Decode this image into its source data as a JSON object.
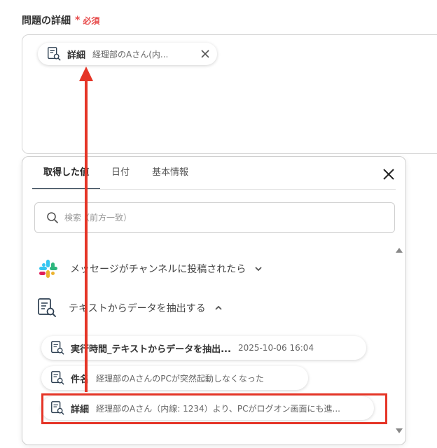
{
  "field": {
    "label": "問題の詳細",
    "required_mark": "*",
    "required_text": "必須",
    "chip": {
      "title": "詳細",
      "value": "経理部のAさん(内..."
    }
  },
  "panel": {
    "tabs": [
      {
        "label": "取得した値",
        "active": true
      },
      {
        "label": "日付",
        "active": false
      },
      {
        "label": "基本情報",
        "active": false
      }
    ],
    "search": {
      "placeholder": "検索（前方一致）",
      "value": ""
    },
    "groups": [
      {
        "label": "メッセージがチャンネルに投稿されたら",
        "icon": "slack-icon",
        "expanded": false
      },
      {
        "label": "テキストからデータを抽出する",
        "icon": "document-search-icon",
        "expanded": true
      }
    ],
    "items": [
      {
        "title": "実行時間_テキストからデータを抽出...",
        "value": "2025-10-06 16:04"
      },
      {
        "title": "件名",
        "value": "経理部のAさんのPCが突然起動しなくなった"
      },
      {
        "title": "詳細",
        "value": "経理部のAさん（内線: 1234）より、PCがログオン画面にも進..."
      }
    ]
  },
  "colors": {
    "annotation_red": "#e53527",
    "icon_navy": "#2c3e50",
    "required_red": "#e74c4c"
  }
}
